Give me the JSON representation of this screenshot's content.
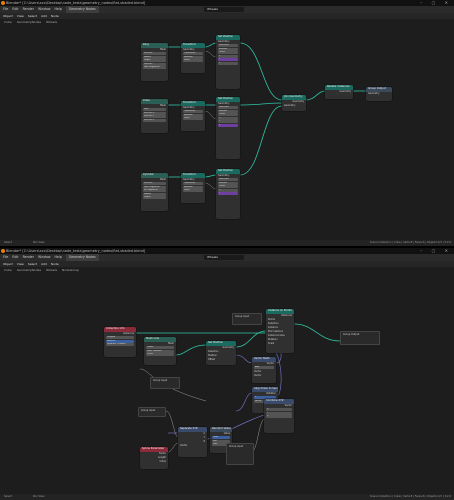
{
  "top": {
    "title": "Blender* [C:\\Users\\xxx\\Desktop\\node_tests\\geometry_nodes\\flat-shaded.blend]",
    "menu": [
      "File",
      "Edit",
      "Render",
      "Window",
      "Help",
      "Geometry Nodes"
    ],
    "workspace_field": "Wheels",
    "header_items": [
      "Object",
      "View",
      "Select",
      "Add",
      "Node"
    ],
    "breadcrumb": [
      "Cube",
      "GeometryNodes",
      "Wheels"
    ],
    "status_left": "Select",
    "status_mid": "Pan View",
    "status_right": "Scene Collection | Cube | Verts:8 | Faces:6 | Objects:1/3 | 3.2.0",
    "nodes": {
      "n1": {
        "title": "Ring",
        "rows": [
          "Mesh",
          "Vertices",
          "Radius",
          "Depth",
          "Vertices",
          "Side Segments"
        ]
      },
      "n2": {
        "title": "Realize Instances",
        "rows": [
          "Geometry",
          "Geometry"
        ]
      },
      "n3": {
        "title": "Set Position",
        "rows": [
          "Geometry",
          "Selection",
          "Position",
          "Offset",
          "X",
          "Y",
          "Z"
        ]
      },
      "n4": {
        "title": "Group Output",
        "rows": [
          "Geometry"
        ]
      },
      "n5": {
        "title": "Join Geometry",
        "rows": [
          "Geometry",
          "Geometry"
        ]
      },
      "n6": {
        "title": "Cube",
        "rows": [
          "Mesh",
          "Size",
          "Vertices X",
          "Vertices Y",
          "Vertices Z"
        ]
      },
      "n7": {
        "title": "Transform",
        "rows": [
          "Geometry",
          "Translation",
          "Rotation",
          "Scale"
        ]
      },
      "n8": {
        "title": "Cylinder",
        "rows": [
          "Mesh",
          "Vertices",
          "Side Segments",
          "Fill Segments",
          "Radius",
          "Depth"
        ]
      },
      "n9": {
        "title": "Transform",
        "rows": [
          "Geometry",
          "Translation",
          "Rotation",
          "Scale"
        ]
      }
    }
  },
  "bottom": {
    "title": "Blender* [C:\\Users\\xxx\\Desktop\\node_tests\\geometry_nodes\\flat-shaded.blend]",
    "menu": [
      "File",
      "Edit",
      "Render",
      "Window",
      "Help",
      "Geometry Nodes"
    ],
    "workspace_field": "Wheels",
    "header_items": [
      "Object",
      "View",
      "Select",
      "Add",
      "Node"
    ],
    "breadcrumb": [
      "Cube",
      "GeometryNodes",
      "Wheels",
      "NodeGroup"
    ],
    "status_left": "Select",
    "status_mid": "Pan View",
    "status_right": "Scene Collection | Cube | Verts:8 | Faces:6 | Objects:1/3 | 3.2.0",
    "nodes": {
      "b1": {
        "title": "Collection Info",
        "rows": [
          "Instances",
          "Original",
          "Relative",
          "Separate Children",
          "Reset Children"
        ]
      },
      "b2": {
        "title": "Group Input",
        "rows": [
          "Geometry"
        ]
      },
      "b3": {
        "title": "Instance on Points",
        "rows": [
          "Instances",
          "Points",
          "Selection",
          "Instance",
          "Pick Instance",
          "Instance Index",
          "Rotation",
          "Scale"
        ]
      },
      "b4": {
        "title": "Group Output",
        "rows": [
          "Geometry"
        ]
      },
      "b5": {
        "title": "Realize Instances",
        "rows": [
          "Geometry",
          "Geometry"
        ]
      },
      "b6": {
        "title": "Set Position",
        "rows": [
          "Geometry",
          "Selection",
          "Position",
          "Offset"
        ]
      },
      "b7": {
        "title": "Mesh Line",
        "rows": [
          "Mesh",
          "Count",
          "Start Location",
          "Offset"
        ]
      },
      "b8": {
        "title": "Vector Math",
        "rows": [
          "Vector",
          "Add",
          "Vector",
          "Vector"
        ]
      },
      "b9": {
        "title": "Align Euler to Vector",
        "rows": [
          "Rotation",
          "X",
          "Auto",
          "Factor",
          "Vector"
        ]
      },
      "b10": {
        "title": "Combine XYZ",
        "rows": [
          "Vector",
          "X",
          "Y",
          "Z"
        ]
      },
      "b11": {
        "title": "Group Input",
        "rows": [
          "Count"
        ]
      },
      "b12": {
        "title": "Random Value",
        "rows": [
          "Value",
          "Float",
          "Min",
          "Max",
          "ID",
          "Seed"
        ]
      },
      "b13": {
        "title": "Group Input",
        "rows": [
          "Length"
        ]
      },
      "b14": {
        "title": "Separate XYZ",
        "rows": [
          "X",
          "Y",
          "Z",
          "Vector"
        ]
      },
      "b15": {
        "title": "Spline Parameter",
        "rows": [
          "Factor",
          "Length",
          "Index"
        ]
      },
      "b16": {
        "title": "Group Input",
        "rows": [
          "Scale"
        ]
      }
    }
  },
  "colors": {
    "geometry_link": "#2ec7a6",
    "background": "#1d1d1d",
    "node_body": "#303030"
  }
}
